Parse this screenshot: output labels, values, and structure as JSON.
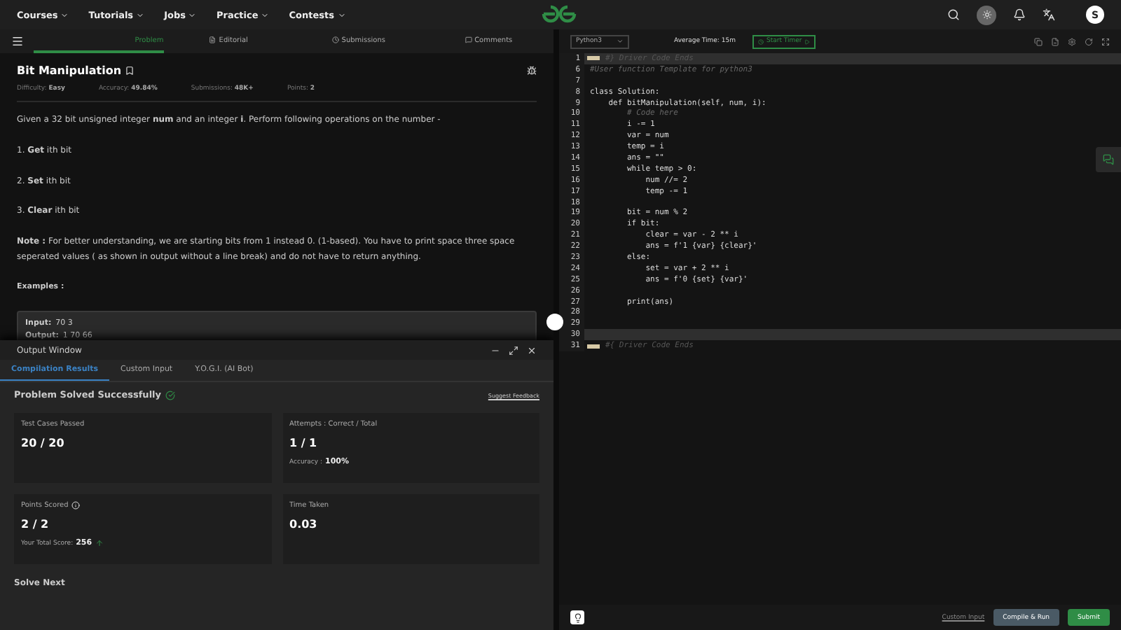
{
  "nav": {
    "menus": [
      "Courses",
      "Tutorials",
      "Jobs",
      "Practice",
      "Contests"
    ],
    "avatar": "S"
  },
  "problem_tabs": [
    {
      "label": "Problem",
      "selected": true
    },
    {
      "label": "Editorial",
      "selected": false
    },
    {
      "label": "Submissions",
      "selected": false
    },
    {
      "label": "Comments",
      "selected": false
    }
  ],
  "problem": {
    "title": "Bit Manipulation",
    "meta": [
      {
        "label": "Difficulty:",
        "value": "Easy"
      },
      {
        "label": "Accuracy:",
        "value": "49.84%"
      },
      {
        "label": "Submissions:",
        "value": "48K+"
      },
      {
        "label": "Points:",
        "value": "2"
      }
    ],
    "statement": "Given a 32 bit unsigned integer **num** and an integer **i**. Perform following operations on the number -",
    "steps": [
      "1. **Get** ith bit",
      "2. **Set** ith bit",
      "3. **Clear** ith bit"
    ],
    "note": "**Note :** For better understanding, we are starting bits from 1 instead 0. (1-based). You have to print space three space seperated values ( as shown in output without a line break) and do not have to return anything.",
    "examples_heading": "Examples :",
    "example": [
      {
        "label": "Input:",
        "value": "70  3"
      },
      {
        "label": "Output:",
        "value": "1  70  66"
      }
    ]
  },
  "output_window": {
    "title": "Output Window",
    "tabs": [
      {
        "label": "Compilation Results",
        "selected": true
      },
      {
        "label": "Custom Input",
        "selected": false
      },
      {
        "label": "Y.O.G.I. (AI Bot)",
        "selected": false
      }
    ],
    "status": "Problem Solved Successfully",
    "feedback_link": "Suggest Feedback",
    "cards": [
      {
        "label": "Test Cases Passed",
        "value": "20 / 20"
      },
      {
        "label": "Attempts : Correct / Total",
        "value": "1 / 1",
        "sub_label": "Accuracy :",
        "sub_value": "100%"
      },
      {
        "label": "Points Scored",
        "value": "2 / 2",
        "info": true,
        "sub_label": "Your Total Score:",
        "sub_value": "256",
        "rising": true
      },
      {
        "label": "Time Taken",
        "value": "0.03"
      }
    ],
    "solve_next": "Solve Next"
  },
  "editor": {
    "language": "Python3",
    "average_time": "Average Time: 15m",
    "timer_button": "Start Timer",
    "lines": [
      {
        "number": "1",
        "text": "#} Driver Code Ends",
        "kind": "folded",
        "highlighted": true
      },
      {
        "number": "6",
        "text": "#User function Template for python3",
        "kind": "comment",
        "highlighted": false
      },
      {
        "number": "7",
        "kind": "code",
        "highlighted": false
      },
      {
        "number": "8",
        "text": "class Solution:",
        "kind": "code",
        "highlighted": false
      },
      {
        "number": "9",
        "text": "    def bitManipulation(self, num, i):",
        "kind": "code",
        "highlighted": false
      },
      {
        "number": "10",
        "text": "        # Code here",
        "kind": "comment",
        "highlighted": false
      },
      {
        "number": "11",
        "text": "        i -= 1",
        "kind": "code",
        "highlighted": false
      },
      {
        "number": "12",
        "text": "        var = num",
        "kind": "code",
        "highlighted": false
      },
      {
        "number": "13",
        "text": "        temp = i",
        "kind": "code",
        "highlighted": false
      },
      {
        "number": "14",
        "text": "        ans = \"\"",
        "kind": "code",
        "highlighted": false
      },
      {
        "number": "15",
        "text": "        while temp > 0:",
        "kind": "code",
        "highlighted": false
      },
      {
        "number": "16",
        "text": "            num //= 2",
        "kind": "code",
        "highlighted": false
      },
      {
        "number": "17",
        "text": "            temp -= 1",
        "kind": "code",
        "highlighted": false
      },
      {
        "number": "18",
        "kind": "code",
        "highlighted": false
      },
      {
        "number": "19",
        "text": "        bit = num % 2",
        "kind": "code",
        "highlighted": false
      },
      {
        "number": "20",
        "text": "        if bit:",
        "kind": "code",
        "highlighted": false
      },
      {
        "number": "21",
        "text": "            clear = var - 2 ** i",
        "kind": "code",
        "highlighted": false
      },
      {
        "number": "22",
        "text": "            ans = f'1 {var} {clear}'",
        "kind": "code",
        "highlighted": false
      },
      {
        "number": "23",
        "text": "        else:",
        "kind": "code",
        "highlighted": false
      },
      {
        "number": "24",
        "text": "            set = var + 2 ** i",
        "kind": "code",
        "highlighted": false
      },
      {
        "number": "25",
        "text": "            ans = f'0 {set} {var}'",
        "kind": "code",
        "highlighted": false
      },
      {
        "number": "26",
        "kind": "code",
        "highlighted": false
      },
      {
        "number": "27",
        "text": "        print(ans)",
        "kind": "code",
        "highlighted": false
      },
      {
        "number": "28",
        "kind": "code",
        "highlighted": false
      },
      {
        "number": "29",
        "kind": "code",
        "highlighted": false
      },
      {
        "number": "30",
        "kind": "code",
        "highlighted": true
      },
      {
        "number": "31",
        "text": "#{ Driver Code Ends",
        "kind": "folded",
        "highlighted": false
      }
    ],
    "custom_input": "Custom Input",
    "compile_button": "Compile & Run",
    "submit_button": "Submit"
  }
}
